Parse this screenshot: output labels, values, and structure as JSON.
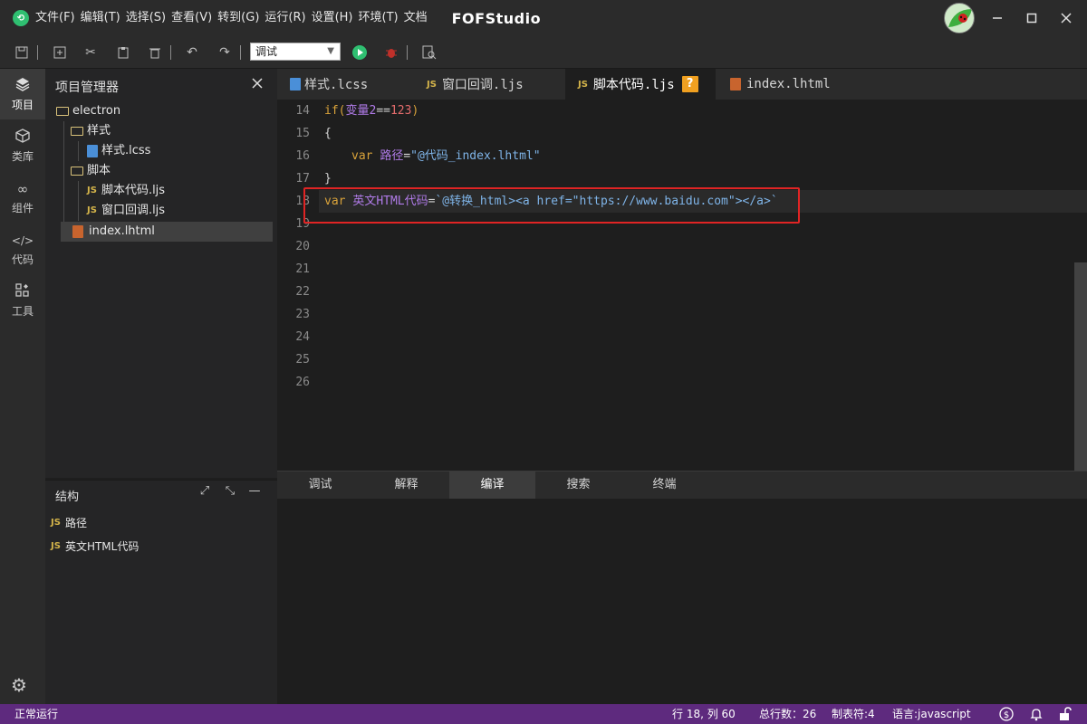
{
  "app": {
    "title": "FOFStudio",
    "logo_icon": "leaf-logo-icon"
  },
  "menu": [
    "文件(F)",
    "编辑(T)",
    "选择(S)",
    "查看(V)",
    "转到(G)",
    "运行(R)",
    "设置(H)",
    "环境(T)",
    "文档"
  ],
  "toolbar": {
    "run_mode": "调试",
    "run_color": "#2fbf71",
    "debug_color": "#c0302a"
  },
  "activity": [
    {
      "id": "project",
      "label": "项目",
      "icon": "layers-icon"
    },
    {
      "id": "library",
      "label": "类库",
      "icon": "cube-icon"
    },
    {
      "id": "components",
      "label": "组件",
      "icon": "link-icon"
    },
    {
      "id": "code",
      "label": "代码",
      "icon": "code-icon"
    },
    {
      "id": "tools",
      "label": "工具",
      "icon": "grid-icon"
    }
  ],
  "explorer": {
    "title": "项目管理器",
    "tree": {
      "root": "electron",
      "folder_style": "样式",
      "file_css": "样式.lcss",
      "folder_script": "脚本",
      "file_script": "脚本代码.ljs",
      "file_window": "窗口回调.ljs",
      "file_index": "index.lhtml"
    }
  },
  "structure": {
    "title": "结构",
    "items": [
      "路径",
      "英文HTML代码"
    ]
  },
  "tabs": [
    {
      "label": "样式.lcss",
      "type": "css"
    },
    {
      "label": "窗口回调.ljs",
      "type": "js"
    },
    {
      "label": "脚本代码.ljs",
      "type": "js",
      "active": true,
      "badge": "?"
    },
    {
      "label": "index.lhtml",
      "type": "html"
    }
  ],
  "editor": {
    "line_numbers": [
      "14",
      "15",
      "16",
      "17",
      "18",
      "19",
      "20",
      "21",
      "22",
      "23",
      "24",
      "25",
      "26"
    ],
    "l14": {
      "kw": "if(",
      "var": "变量2",
      "op": "==",
      "num": "123",
      "end": ")"
    },
    "l15": "{",
    "l16": {
      "kw": "var",
      "var": "路径",
      "op": "=",
      "str": "\"@代码_index.lhtml\""
    },
    "l17": "}",
    "l18": {
      "kw": "var",
      "var": "英文HTML代码",
      "op": "=",
      "str": "`@转换_html><a href=\"https://www.baidu.com\"></a>`"
    }
  },
  "bottom_tabs": [
    "调试",
    "解释",
    "编译",
    "搜索",
    "终端"
  ],
  "status": {
    "left": "正常运行",
    "cursor": "行 18, 列 60",
    "total_lines": "总行数：26",
    "tab_size": "制表符:4",
    "language": "语言:javascript",
    "bar_color": "#5e2a7e"
  }
}
